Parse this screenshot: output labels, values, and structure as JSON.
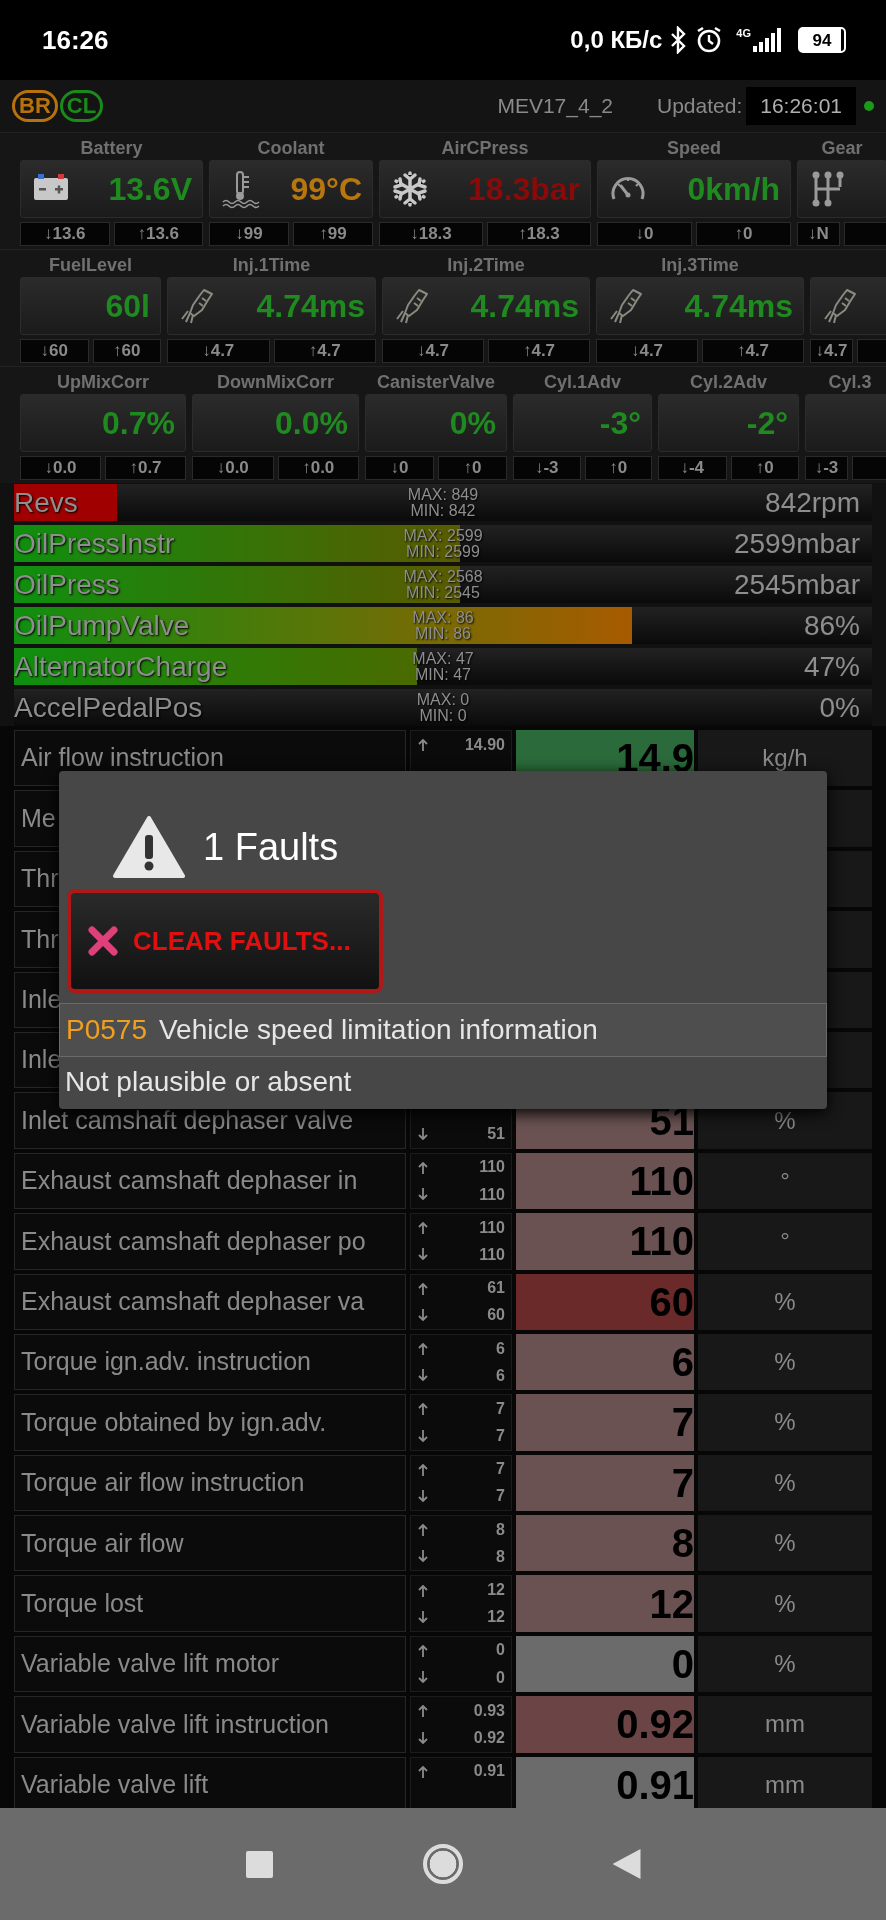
{
  "status_bar": {
    "time": "16:26",
    "net_speed": "0,0 КБ/с",
    "network": "4G",
    "battery": "94"
  },
  "header": {
    "badges": [
      {
        "label": "BR",
        "color": "#b8720c"
      },
      {
        "label": "CL",
        "color": "#1a8a1a"
      }
    ],
    "ecu": "MEV17_4_2",
    "updated_label": "Updated:",
    "updated_time": "16:26:01",
    "online": true
  },
  "gauge_rows": [
    [
      {
        "label": "Battery",
        "kind": "battery",
        "value": "13.6V",
        "color": "#1f8a1f",
        "min": "↓13.6",
        "max": "↑13.6"
      },
      {
        "label": "Coolant",
        "kind": "thermometer",
        "value": "99°C",
        "color": "#b8760e",
        "min": "↓99",
        "max": "↑99"
      },
      {
        "label": "AirCPress",
        "kind": "snowflake",
        "value": "18.3bar",
        "color": "#8a0a0a",
        "min": "↓18.3",
        "max": "↑18.3"
      },
      {
        "label": "Speed",
        "kind": "speedometer",
        "value": "0km/h",
        "color": "#1f8a1f",
        "min": "↓0",
        "max": "↑0"
      },
      {
        "label": "Gear",
        "kind": "gearshift",
        "min": "↓N"
      }
    ],
    [
      {
        "label": "FuelLevel",
        "value": "60l",
        "color": "#1f8a1f",
        "min": "↓60",
        "max": "↑60"
      },
      {
        "label": "Inj.1Time",
        "kind": "injector",
        "value": "4.74ms",
        "color": "#1f8a1f",
        "min": "↓4.7",
        "max": "↑4.7"
      },
      {
        "label": "Inj.2Time",
        "kind": "injector",
        "value": "4.74ms",
        "color": "#1f8a1f",
        "min": "↓4.7",
        "max": "↑4.7"
      },
      {
        "label": "Inj.3Time",
        "kind": "injector",
        "value": "4.74ms",
        "color": "#1f8a1f",
        "min": "↓4.7",
        "max": "↑4.7"
      },
      {
        "kind": "injector",
        "min": "↓4.7"
      }
    ],
    [
      {
        "label": "UpMixCorr",
        "value": "0.7%",
        "color": "#1f8a1f",
        "min": "↓0.0",
        "max": "↑0.7"
      },
      {
        "label": "DownMixCorr",
        "value": "0.0%",
        "color": "#1f8a1f",
        "min": "↓0.0",
        "max": "↑0.0"
      },
      {
        "label": "CanisterValve",
        "value": "0%",
        "color": "#1f8a1f",
        "min": "↓0",
        "max": "↑0"
      },
      {
        "label": "Cyl.1Adv",
        "value": "-3°",
        "color": "#1f8a1f",
        "min": "↓-3",
        "max": "↑0"
      },
      {
        "label": "Cyl.2Adv",
        "value": "-2°",
        "color": "#1f8a1f",
        "min": "↓-4",
        "max": "↑0"
      },
      {
        "label": "Cyl.3",
        "min": "↓-3"
      }
    ]
  ],
  "bars": [
    {
      "label": "Revs",
      "kind": "solid",
      "color": "#a00000",
      "level": 0.12,
      "max": "MAX: 849",
      "min": "MIN: 842",
      "reading": "842rpm"
    },
    {
      "label": "OilPressInstr",
      "kind": "gradient",
      "color": "#5a5a00",
      "level": 0.52,
      "max": "MAX: 2599",
      "min": "MIN: 2599",
      "reading": "2599mbar"
    },
    {
      "label": "OilPress",
      "kind": "gradient",
      "color": "#5a5a00",
      "level": 0.52,
      "max": "MAX: 2568",
      "min": "MIN: 2545",
      "reading": "2545mbar"
    },
    {
      "label": "OilPumpValve",
      "kind": "gradient",
      "color": "#a85a00",
      "level": 0.72,
      "max": "MAX: 86",
      "min": "MIN: 86",
      "reading": "86%"
    },
    {
      "label": "AlternatorCharge",
      "kind": "gradient",
      "color": "#4a6a00",
      "level": 0.47,
      "max": "MAX: 47",
      "min": "MIN: 47",
      "reading": "47%"
    },
    {
      "label": "AccelPedalPos",
      "max": "MAX: 0",
      "min": "MIN: 0",
      "reading": "0%"
    }
  ],
  "table": {
    "rows": [
      {
        "name": "Air flow instruction",
        "up": "14.90",
        "value": "14.9",
        "unit": "kg/h",
        "color": "#2b6a3a"
      },
      {
        "name": "Me"
      },
      {
        "name": "Thr"
      },
      {
        "name": "Thr"
      },
      {
        "name": "Inle"
      },
      {
        "name": "Inle"
      },
      {
        "name": "Inlet camshaft dephaser valve",
        "down": "51",
        "value": "51",
        "unit": "%",
        "color": "#6b5252"
      },
      {
        "name": "Exhaust camshaft dephaser in",
        "up": "110",
        "down": "110",
        "value": "110",
        "unit": "°",
        "color": "#6b5252"
      },
      {
        "name": "Exhaust camshaft dephaser po",
        "up": "110",
        "down": "110",
        "value": "110",
        "unit": "°",
        "color": "#6b5252"
      },
      {
        "name": "Exhaust camshaft dephaser va",
        "up": "61",
        "down": "60",
        "value": "60",
        "unit": "%",
        "color": "#6b2a2a"
      },
      {
        "name": "Torque ign.adv. instruction",
        "up": "6",
        "down": "6",
        "value": "6",
        "unit": "%",
        "color": "#6b5252"
      },
      {
        "name": "Torque obtained by ign.adv.",
        "up": "7",
        "down": "7",
        "value": "7",
        "unit": "%",
        "color": "#6b5252"
      },
      {
        "name": "Torque air flow instruction",
        "up": "7",
        "down": "7",
        "value": "7",
        "unit": "%",
        "color": "#6b5252"
      },
      {
        "name": "Torque air flow",
        "up": "8",
        "down": "8",
        "value": "8",
        "unit": "%",
        "color": "#6b5252"
      },
      {
        "name": "Torque lost",
        "up": "12",
        "down": "12",
        "value": "12",
        "unit": "%",
        "color": "#6b5252"
      },
      {
        "name": "Variable valve lift motor",
        "up": "0",
        "down": "0",
        "value": "0",
        "unit": "%",
        "color": "#6b6b6b"
      },
      {
        "name": "Variable valve lift instruction",
        "up": "0.93",
        "down": "0.92",
        "value": "0.92",
        "unit": "mm",
        "color": "#6b4545"
      },
      {
        "name": "Variable valve lift",
        "up": "0.91",
        "value": "0.91",
        "unit": "mm",
        "color": "#6b6b6b"
      }
    ]
  },
  "dialog": {
    "title": "1 Faults",
    "clear_button": "CLEAR FAULTS...",
    "faults": [
      {
        "code": "P0575",
        "description": "Vehicle speed limitation information",
        "detail": "Not plausible or absent"
      }
    ]
  }
}
